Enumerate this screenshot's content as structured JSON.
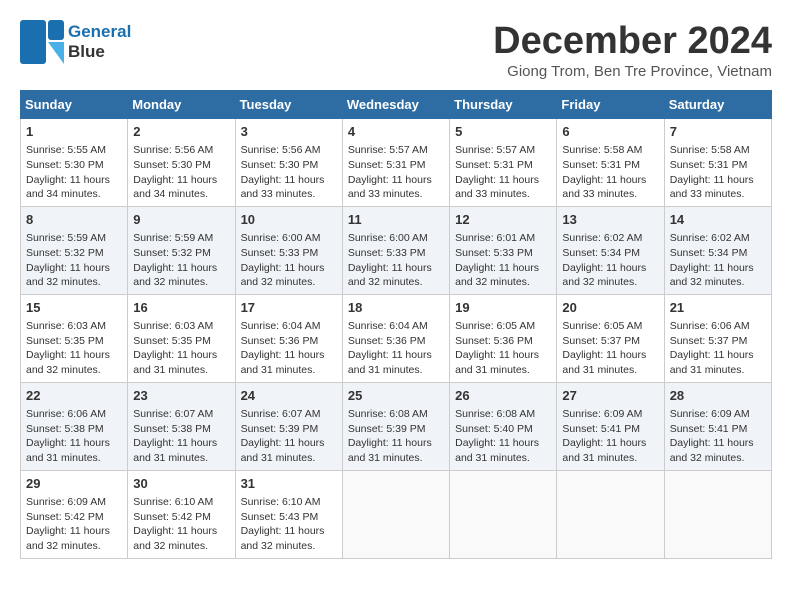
{
  "logo": {
    "line1": "General",
    "line2": "Blue"
  },
  "title": "December 2024",
  "subtitle": "Giong Trom, Ben Tre Province, Vietnam",
  "weekdays": [
    "Sunday",
    "Monday",
    "Tuesday",
    "Wednesday",
    "Thursday",
    "Friday",
    "Saturday"
  ],
  "weeks": [
    [
      {
        "day": "1",
        "detail": "Sunrise: 5:55 AM\nSunset: 5:30 PM\nDaylight: 11 hours\nand 34 minutes."
      },
      {
        "day": "2",
        "detail": "Sunrise: 5:56 AM\nSunset: 5:30 PM\nDaylight: 11 hours\nand 34 minutes."
      },
      {
        "day": "3",
        "detail": "Sunrise: 5:56 AM\nSunset: 5:30 PM\nDaylight: 11 hours\nand 33 minutes."
      },
      {
        "day": "4",
        "detail": "Sunrise: 5:57 AM\nSunset: 5:31 PM\nDaylight: 11 hours\nand 33 minutes."
      },
      {
        "day": "5",
        "detail": "Sunrise: 5:57 AM\nSunset: 5:31 PM\nDaylight: 11 hours\nand 33 minutes."
      },
      {
        "day": "6",
        "detail": "Sunrise: 5:58 AM\nSunset: 5:31 PM\nDaylight: 11 hours\nand 33 minutes."
      },
      {
        "day": "7",
        "detail": "Sunrise: 5:58 AM\nSunset: 5:31 PM\nDaylight: 11 hours\nand 33 minutes."
      }
    ],
    [
      {
        "day": "8",
        "detail": "Sunrise: 5:59 AM\nSunset: 5:32 PM\nDaylight: 11 hours\nand 32 minutes."
      },
      {
        "day": "9",
        "detail": "Sunrise: 5:59 AM\nSunset: 5:32 PM\nDaylight: 11 hours\nand 32 minutes."
      },
      {
        "day": "10",
        "detail": "Sunrise: 6:00 AM\nSunset: 5:33 PM\nDaylight: 11 hours\nand 32 minutes."
      },
      {
        "day": "11",
        "detail": "Sunrise: 6:00 AM\nSunset: 5:33 PM\nDaylight: 11 hours\nand 32 minutes."
      },
      {
        "day": "12",
        "detail": "Sunrise: 6:01 AM\nSunset: 5:33 PM\nDaylight: 11 hours\nand 32 minutes."
      },
      {
        "day": "13",
        "detail": "Sunrise: 6:02 AM\nSunset: 5:34 PM\nDaylight: 11 hours\nand 32 minutes."
      },
      {
        "day": "14",
        "detail": "Sunrise: 6:02 AM\nSunset: 5:34 PM\nDaylight: 11 hours\nand 32 minutes."
      }
    ],
    [
      {
        "day": "15",
        "detail": "Sunrise: 6:03 AM\nSunset: 5:35 PM\nDaylight: 11 hours\nand 32 minutes."
      },
      {
        "day": "16",
        "detail": "Sunrise: 6:03 AM\nSunset: 5:35 PM\nDaylight: 11 hours\nand 31 minutes."
      },
      {
        "day": "17",
        "detail": "Sunrise: 6:04 AM\nSunset: 5:36 PM\nDaylight: 11 hours\nand 31 minutes."
      },
      {
        "day": "18",
        "detail": "Sunrise: 6:04 AM\nSunset: 5:36 PM\nDaylight: 11 hours\nand 31 minutes."
      },
      {
        "day": "19",
        "detail": "Sunrise: 6:05 AM\nSunset: 5:36 PM\nDaylight: 11 hours\nand 31 minutes."
      },
      {
        "day": "20",
        "detail": "Sunrise: 6:05 AM\nSunset: 5:37 PM\nDaylight: 11 hours\nand 31 minutes."
      },
      {
        "day": "21",
        "detail": "Sunrise: 6:06 AM\nSunset: 5:37 PM\nDaylight: 11 hours\nand 31 minutes."
      }
    ],
    [
      {
        "day": "22",
        "detail": "Sunrise: 6:06 AM\nSunset: 5:38 PM\nDaylight: 11 hours\nand 31 minutes."
      },
      {
        "day": "23",
        "detail": "Sunrise: 6:07 AM\nSunset: 5:38 PM\nDaylight: 11 hours\nand 31 minutes."
      },
      {
        "day": "24",
        "detail": "Sunrise: 6:07 AM\nSunset: 5:39 PM\nDaylight: 11 hours\nand 31 minutes."
      },
      {
        "day": "25",
        "detail": "Sunrise: 6:08 AM\nSunset: 5:39 PM\nDaylight: 11 hours\nand 31 minutes."
      },
      {
        "day": "26",
        "detail": "Sunrise: 6:08 AM\nSunset: 5:40 PM\nDaylight: 11 hours\nand 31 minutes."
      },
      {
        "day": "27",
        "detail": "Sunrise: 6:09 AM\nSunset: 5:41 PM\nDaylight: 11 hours\nand 31 minutes."
      },
      {
        "day": "28",
        "detail": "Sunrise: 6:09 AM\nSunset: 5:41 PM\nDaylight: 11 hours\nand 32 minutes."
      }
    ],
    [
      {
        "day": "29",
        "detail": "Sunrise: 6:09 AM\nSunset: 5:42 PM\nDaylight: 11 hours\nand 32 minutes."
      },
      {
        "day": "30",
        "detail": "Sunrise: 6:10 AM\nSunset: 5:42 PM\nDaylight: 11 hours\nand 32 minutes."
      },
      {
        "day": "31",
        "detail": "Sunrise: 6:10 AM\nSunset: 5:43 PM\nDaylight: 11 hours\nand 32 minutes."
      },
      null,
      null,
      null,
      null
    ]
  ]
}
